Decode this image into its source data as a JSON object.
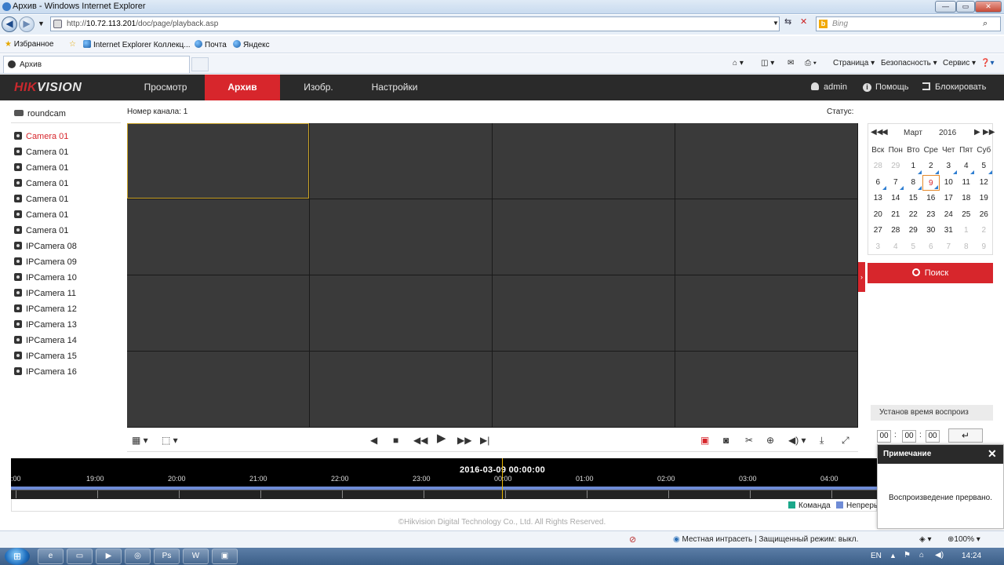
{
  "browser": {
    "window_title": "Архив - Windows Internet Explorer",
    "url_prefix": "http://",
    "url_host": "10.72.113.201",
    "url_path": "/doc/page/playback.asp",
    "search_placeholder": "Bing",
    "favorites_label": "Избранное",
    "favorites": [
      "Internet Explorer Коллекц...",
      "Почта",
      "Яндекс"
    ],
    "tab_title": "Архив",
    "commands": {
      "page": "Страница ▾",
      "security": "Безопасность ▾",
      "tools": "Сервис ▾"
    },
    "status_zone": "Местная интрасеть | Защищенный режим: выкл.",
    "zoom": "100%"
  },
  "app": {
    "logo_hik": "HIK",
    "logo_vision": "VISION",
    "menu": [
      "Просмотр",
      "Архив",
      "Изобр.",
      "Настройки"
    ],
    "active_menu": "Архив",
    "user": "admin",
    "help": "Помощь",
    "logout": "Блокировать"
  },
  "camera_tree": {
    "root": "roundcam",
    "cameras": [
      "Camera 01",
      "Camera 01",
      "Camera 01",
      "Camera 01",
      "Camera 01",
      "Camera 01",
      "Camera 01",
      "IPCamera 08",
      "IPCamera 09",
      "IPCamera 10",
      "IPCamera 11",
      "IPCamera 12",
      "IPCamera 13",
      "IPCamera 14",
      "IPCamera 15",
      "IPCamera 16"
    ],
    "selected_index": 0
  },
  "playback": {
    "channel_label": "Номер канала: 1",
    "status_label": "Статус:",
    "grid_rows": 4,
    "grid_cols": 4,
    "selected_cell": 0
  },
  "calendar": {
    "month": "Март",
    "year": "2016",
    "weekdays": [
      "Вск",
      "Пон",
      "Вто",
      "Сре",
      "Чет",
      "Пят",
      "Суб"
    ],
    "days": [
      {
        "d": "28",
        "dim": true
      },
      {
        "d": "29",
        "dim": true
      },
      {
        "d": "1",
        "rec": true
      },
      {
        "d": "2",
        "rec": true
      },
      {
        "d": "3",
        "rec": true
      },
      {
        "d": "4",
        "rec": true
      },
      {
        "d": "5",
        "rec": true
      },
      {
        "d": "6",
        "rec": true
      },
      {
        "d": "7",
        "rec": true
      },
      {
        "d": "8",
        "rec": true
      },
      {
        "d": "9",
        "rec": true,
        "today": true
      },
      {
        "d": "10"
      },
      {
        "d": "11"
      },
      {
        "d": "12"
      },
      {
        "d": "13"
      },
      {
        "d": "14"
      },
      {
        "d": "15"
      },
      {
        "d": "16"
      },
      {
        "d": "17"
      },
      {
        "d": "18"
      },
      {
        "d": "19"
      },
      {
        "d": "20"
      },
      {
        "d": "21"
      },
      {
        "d": "22"
      },
      {
        "d": "23"
      },
      {
        "d": "24"
      },
      {
        "d": "25"
      },
      {
        "d": "26"
      },
      {
        "d": "27"
      },
      {
        "d": "28"
      },
      {
        "d": "29"
      },
      {
        "d": "30"
      },
      {
        "d": "31"
      },
      {
        "d": "1",
        "dim": true
      },
      {
        "d": "2",
        "dim": true
      },
      {
        "d": "3",
        "dim": true
      },
      {
        "d": "4",
        "dim": true
      },
      {
        "d": "5",
        "dim": true
      },
      {
        "d": "6",
        "dim": true
      },
      {
        "d": "7",
        "dim": true
      },
      {
        "d": "8",
        "dim": true
      },
      {
        "d": "9",
        "dim": true
      }
    ],
    "search_label": "Поиск"
  },
  "set_time": {
    "title": "Установ время воспроиз",
    "hh": "00",
    "mm": "00",
    "ss": "00"
  },
  "timeline": {
    "current": "2016-03-09 00:00:00",
    "ticks": [
      ":00",
      "19:00",
      "20:00",
      "21:00",
      "22:00",
      "23:00",
      "00:00",
      "01:00",
      "02:00",
      "03:00",
      "04:00"
    ],
    "legend": [
      {
        "label": "Команда",
        "color": "#1aa88a"
      },
      {
        "label": "Непреры",
        "color": "#6f8cd6"
      }
    ]
  },
  "footer": "©Hikvision Digital Technology Co., Ltd. All Rights Reserved.",
  "notice": {
    "title": "Примечание",
    "message": "Воспроизведение прервано."
  },
  "taskbar": {
    "lang": "EN",
    "clock": "14:24"
  },
  "colors": {
    "accent": "#d7262c",
    "header_bg": "#2a2a2a",
    "video_bg": "#3a3a3a",
    "selection": "#c9a227"
  }
}
